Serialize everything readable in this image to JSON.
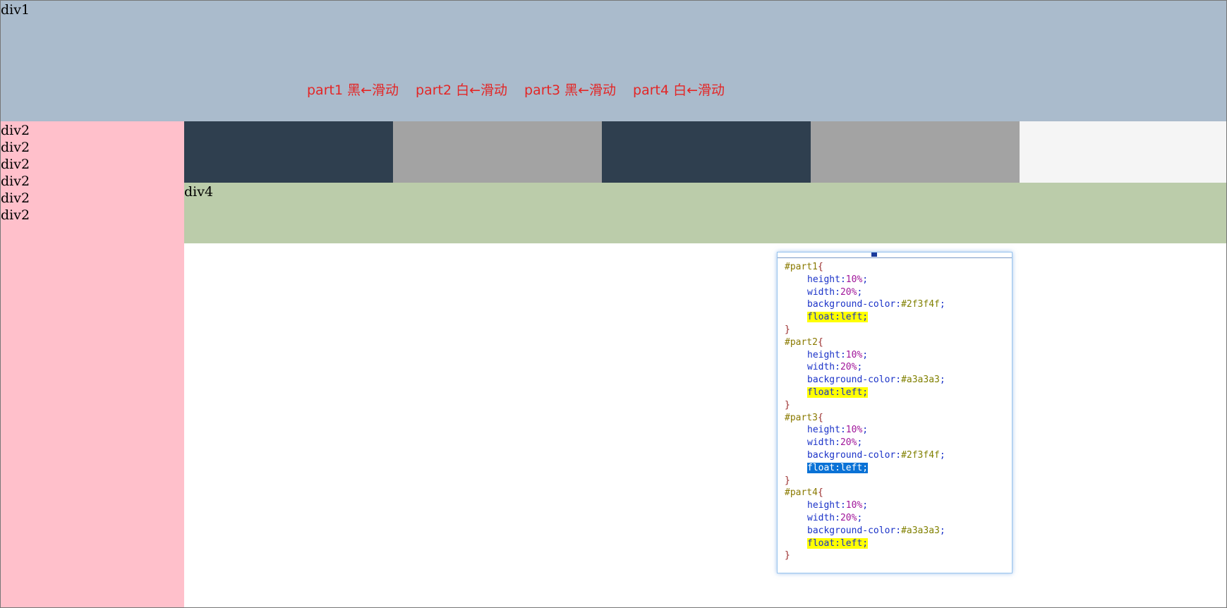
{
  "div1": {
    "label": "div1"
  },
  "nav": [
    "part1 黑←滑动",
    "part2 白←滑动",
    "part3 黑←滑动",
    "part4 白←滑动"
  ],
  "div2": {
    "lines": [
      "div2",
      "div2",
      "div2",
      "div2",
      "div2",
      "div2"
    ]
  },
  "div4": {
    "label": "div4"
  },
  "parts": [
    {
      "name": "part1",
      "color": "#2f3f4f"
    },
    {
      "name": "part2",
      "color": "#a3a3a3"
    },
    {
      "name": "part3",
      "color": "#2f3f4f"
    },
    {
      "name": "part4",
      "color": "#a3a3a3"
    }
  ],
  "code": [
    {
      "selector": "#part1",
      "height": "10%",
      "width": "20%",
      "bg": "#2f3f4f",
      "float": "float:left;",
      "highlight": "yellow"
    },
    {
      "selector": "#part2",
      "height": "10%",
      "width": "20%",
      "bg": "#a3a3a3",
      "float": "float:left;",
      "highlight": "yellow"
    },
    {
      "selector": "#part3",
      "height": "10%",
      "width": "20%",
      "bg": "#2f3f4f",
      "float": "float:left;",
      "highlight": "blue"
    },
    {
      "selector": "#part4",
      "height": "10%",
      "width": "20%",
      "bg": "#a3a3a3",
      "float": "float:left;",
      "highlight": "yellow"
    }
  ]
}
